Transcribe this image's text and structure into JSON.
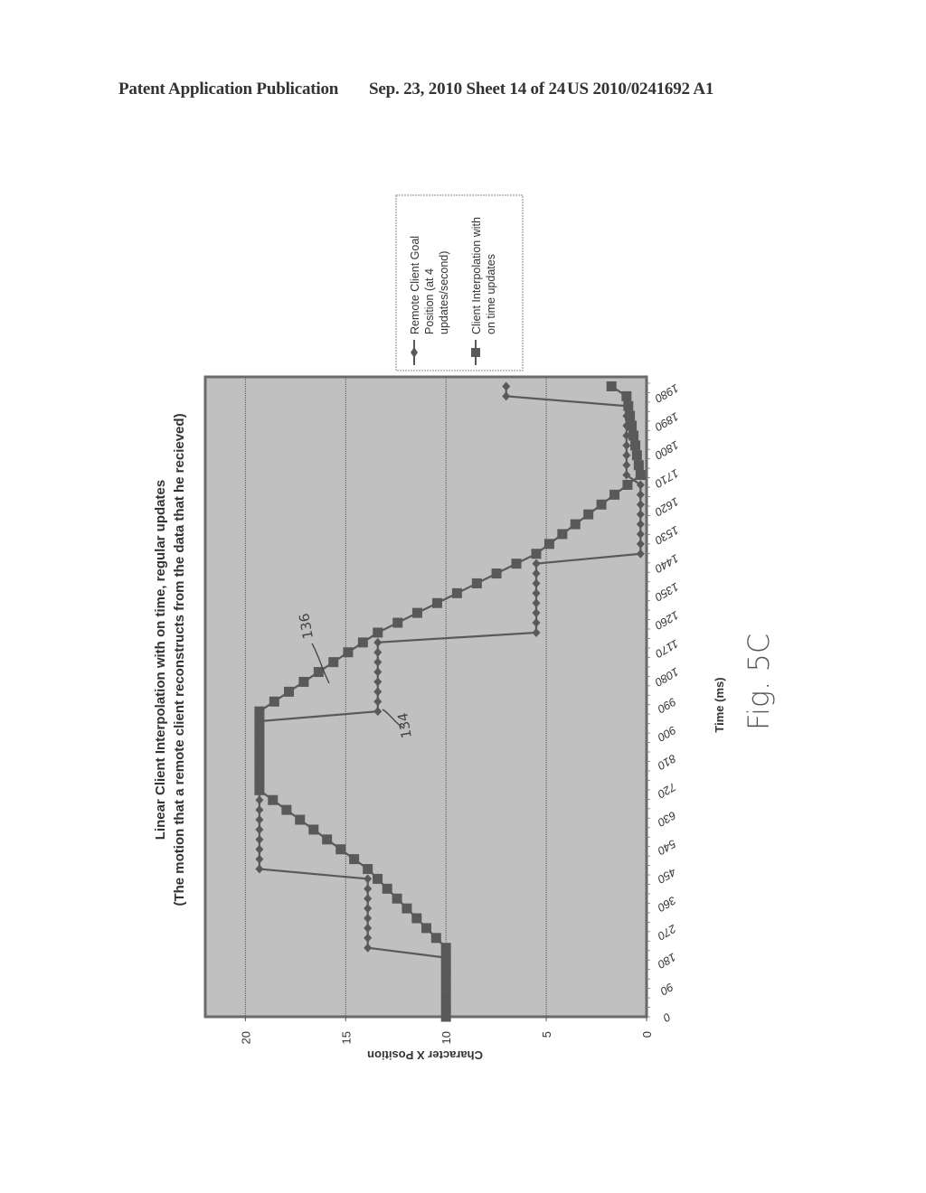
{
  "header": {
    "publication": "Patent Application Publication",
    "date_sheet": "Sep. 23, 2010   Sheet 14 of 24",
    "patent_number": "US 2010/0241692 A1"
  },
  "figure_label": "Fig. 5C",
  "annotations": {
    "goal_series_ref": "134",
    "client_series_ref": "136"
  },
  "colors": {
    "plot_background": "#c0c0c0",
    "series": "#595959",
    "frame": "#6a6a6a"
  },
  "chart_data": {
    "type": "line",
    "orientation": "rotated-90-ccw",
    "title": "Linear Client Interpolation with on time, regular updates",
    "subtitle": "(The motion that a remote client reconstructs from the data that he recieved)",
    "xlabel": "Time (ms)",
    "ylabel": "Character X Position",
    "xlim": [
      0,
      2030
    ],
    "ylim": [
      0,
      22
    ],
    "x_ticks": [
      "0",
      "90",
      "180",
      "270",
      "360",
      "450",
      "540",
      "630",
      "720",
      "810",
      "900",
      "990",
      "1080",
      "1170",
      "1260",
      "1350",
      "1440",
      "1530",
      "1620",
      "1710",
      "1800",
      "1890",
      "1980"
    ],
    "y_ticks": [
      "0",
      "5",
      "10",
      "15",
      "20"
    ],
    "grid": "horizontal major",
    "legend_placement": "right",
    "x": [
      0,
      31.25,
      62.5,
      93.75,
      125,
      156.25,
      187.5,
      218.75,
      250,
      281.25,
      312.5,
      343.75,
      375,
      406.25,
      437.5,
      468.75,
      500,
      531.25,
      562.5,
      593.75,
      625,
      656.25,
      687.5,
      718.75,
      750,
      781.25,
      812.5,
      843.75,
      875,
      906.25,
      937.5,
      968.75,
      1000,
      1031.25,
      1062.5,
      1093.75,
      1125,
      1156.25,
      1187.5,
      1218.75,
      1250,
      1281.25,
      1312.5,
      1343.75,
      1375,
      1406.25,
      1437.5,
      1468.75,
      1500,
      1531.25,
      1562.5,
      1593.75,
      1625,
      1656.25,
      1687.5,
      1718.75,
      1750,
      1781.25,
      1812.5,
      1843.75,
      1875,
      1906.25,
      1937.5,
      1968.75,
      2000,
      2031.25
    ],
    "series": [
      {
        "name": "Remote Client Goal Position (at 4 updates/second)",
        "marker": "diamond",
        "values": [
          10,
          10,
          10,
          10,
          10,
          10,
          10,
          13.9,
          13.9,
          13.9,
          13.9,
          13.9,
          13.9,
          13.9,
          13.9,
          19.3,
          19.3,
          19.3,
          19.3,
          19.3,
          19.3,
          19.3,
          19.3,
          19.3,
          19.3,
          19.3,
          19.3,
          19.3,
          19.3,
          19.3,
          19.3,
          13.4,
          13.4,
          13.4,
          13.4,
          13.4,
          13.4,
          13.4,
          13.4,
          5.5,
          5.5,
          5.5,
          5.5,
          5.5,
          5.5,
          5.5,
          5.5,
          0.3,
          0.3,
          0.3,
          0.3,
          0.3,
          0.3,
          0.3,
          0.3,
          1.0,
          1.0,
          1.0,
          1.0,
          1.0,
          1.0,
          1.0,
          1.0,
          7.0,
          7.0,
          7.0
        ]
      },
      {
        "name": "Client Interpolation with on time updates",
        "marker": "square",
        "values": [
          10,
          10,
          10,
          10,
          10,
          10,
          10,
          10,
          10.49,
          10.98,
          11.46,
          11.95,
          12.44,
          12.93,
          13.41,
          13.9,
          14.58,
          15.25,
          15.93,
          16.6,
          17.28,
          17.95,
          18.63,
          19.3,
          19.3,
          19.3,
          19.3,
          19.3,
          19.3,
          19.3,
          19.3,
          19.3,
          18.56,
          17.83,
          17.09,
          16.35,
          15.61,
          14.88,
          14.14,
          13.4,
          12.41,
          11.43,
          10.44,
          9.45,
          8.46,
          7.48,
          6.49,
          5.5,
          4.85,
          4.2,
          3.55,
          2.9,
          2.25,
          1.6,
          0.95,
          0.3,
          0.39,
          0.48,
          0.56,
          0.65,
          0.74,
          0.83,
          0.91,
          1.0,
          1.75,
          2.5
        ]
      }
    ]
  }
}
